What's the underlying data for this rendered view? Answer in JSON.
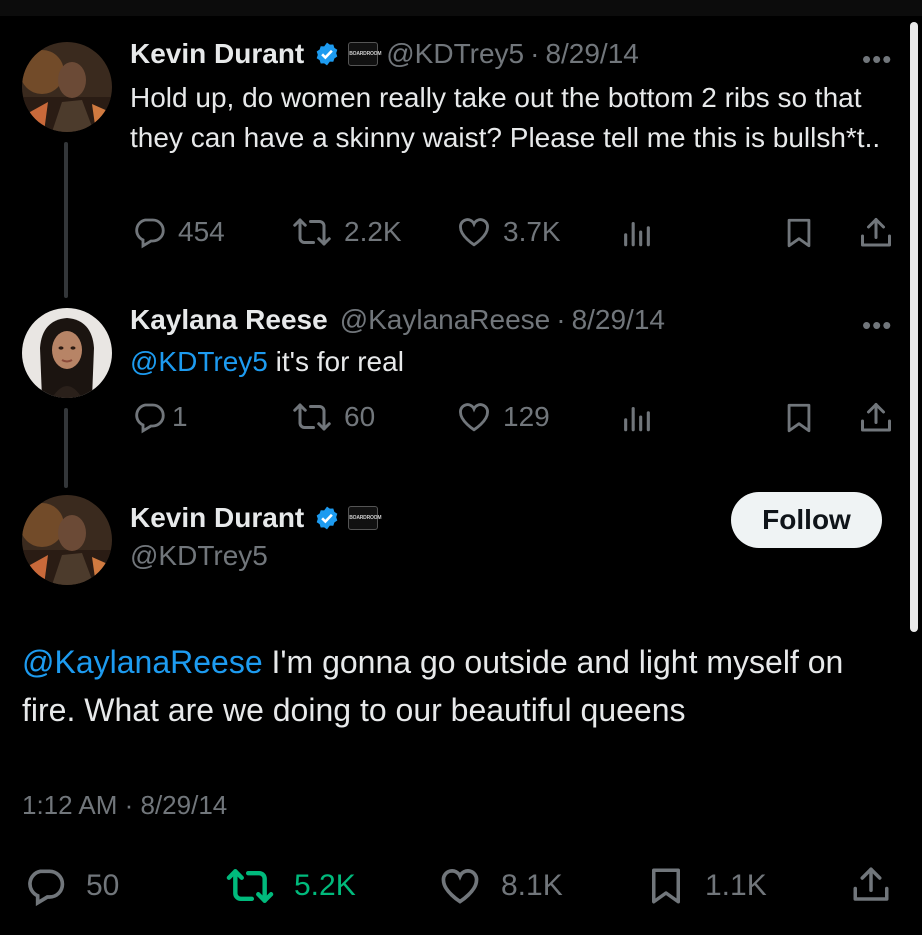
{
  "tweet1": {
    "name": "Kevin Durant",
    "badge": "BOARDROOM",
    "handle": "@KDTrey5",
    "sep": "·",
    "date": "8/29/14",
    "more": "•••",
    "text": "Hold up, do women really take out the bottom 2 ribs so that they can have a skinny waist? Please tell me this is bullsh*t..",
    "replies": "454",
    "retweets": "2.2K",
    "likes": "3.7K"
  },
  "tweet2": {
    "name": "Kaylana Reese",
    "handle": "@KaylanaReese",
    "sep": "·",
    "date": "8/29/14",
    "more": "•••",
    "mention": "@KDTrey5",
    "text": " it's for real",
    "replies": "1",
    "retweets": "60",
    "likes": "129"
  },
  "main": {
    "name": "Kevin Durant",
    "badge": "BOARDROOM",
    "handle": "@KDTrey5",
    "follow_label": "Follow",
    "mention": "@KaylanaReese",
    "text": " I'm gonna go outside and light myself on fire. What are we doing to our beautiful queens",
    "timestamp": "1:12 AM · 8/29/14",
    "replies": "50",
    "retweets": "5.2K",
    "likes": "8.1K",
    "bookmarks": "1.1K"
  },
  "colors": {
    "background": "#000000",
    "text": "#e7e9ea",
    "muted": "#71767b",
    "link": "#1d9bf0",
    "verified": "#1d9bf0",
    "retweeted": "#00ba7c"
  },
  "icons": [
    "reply-icon",
    "retweet-icon",
    "like-icon",
    "views-icon",
    "bookmark-icon",
    "share-icon",
    "verified-icon",
    "more-icon"
  ]
}
